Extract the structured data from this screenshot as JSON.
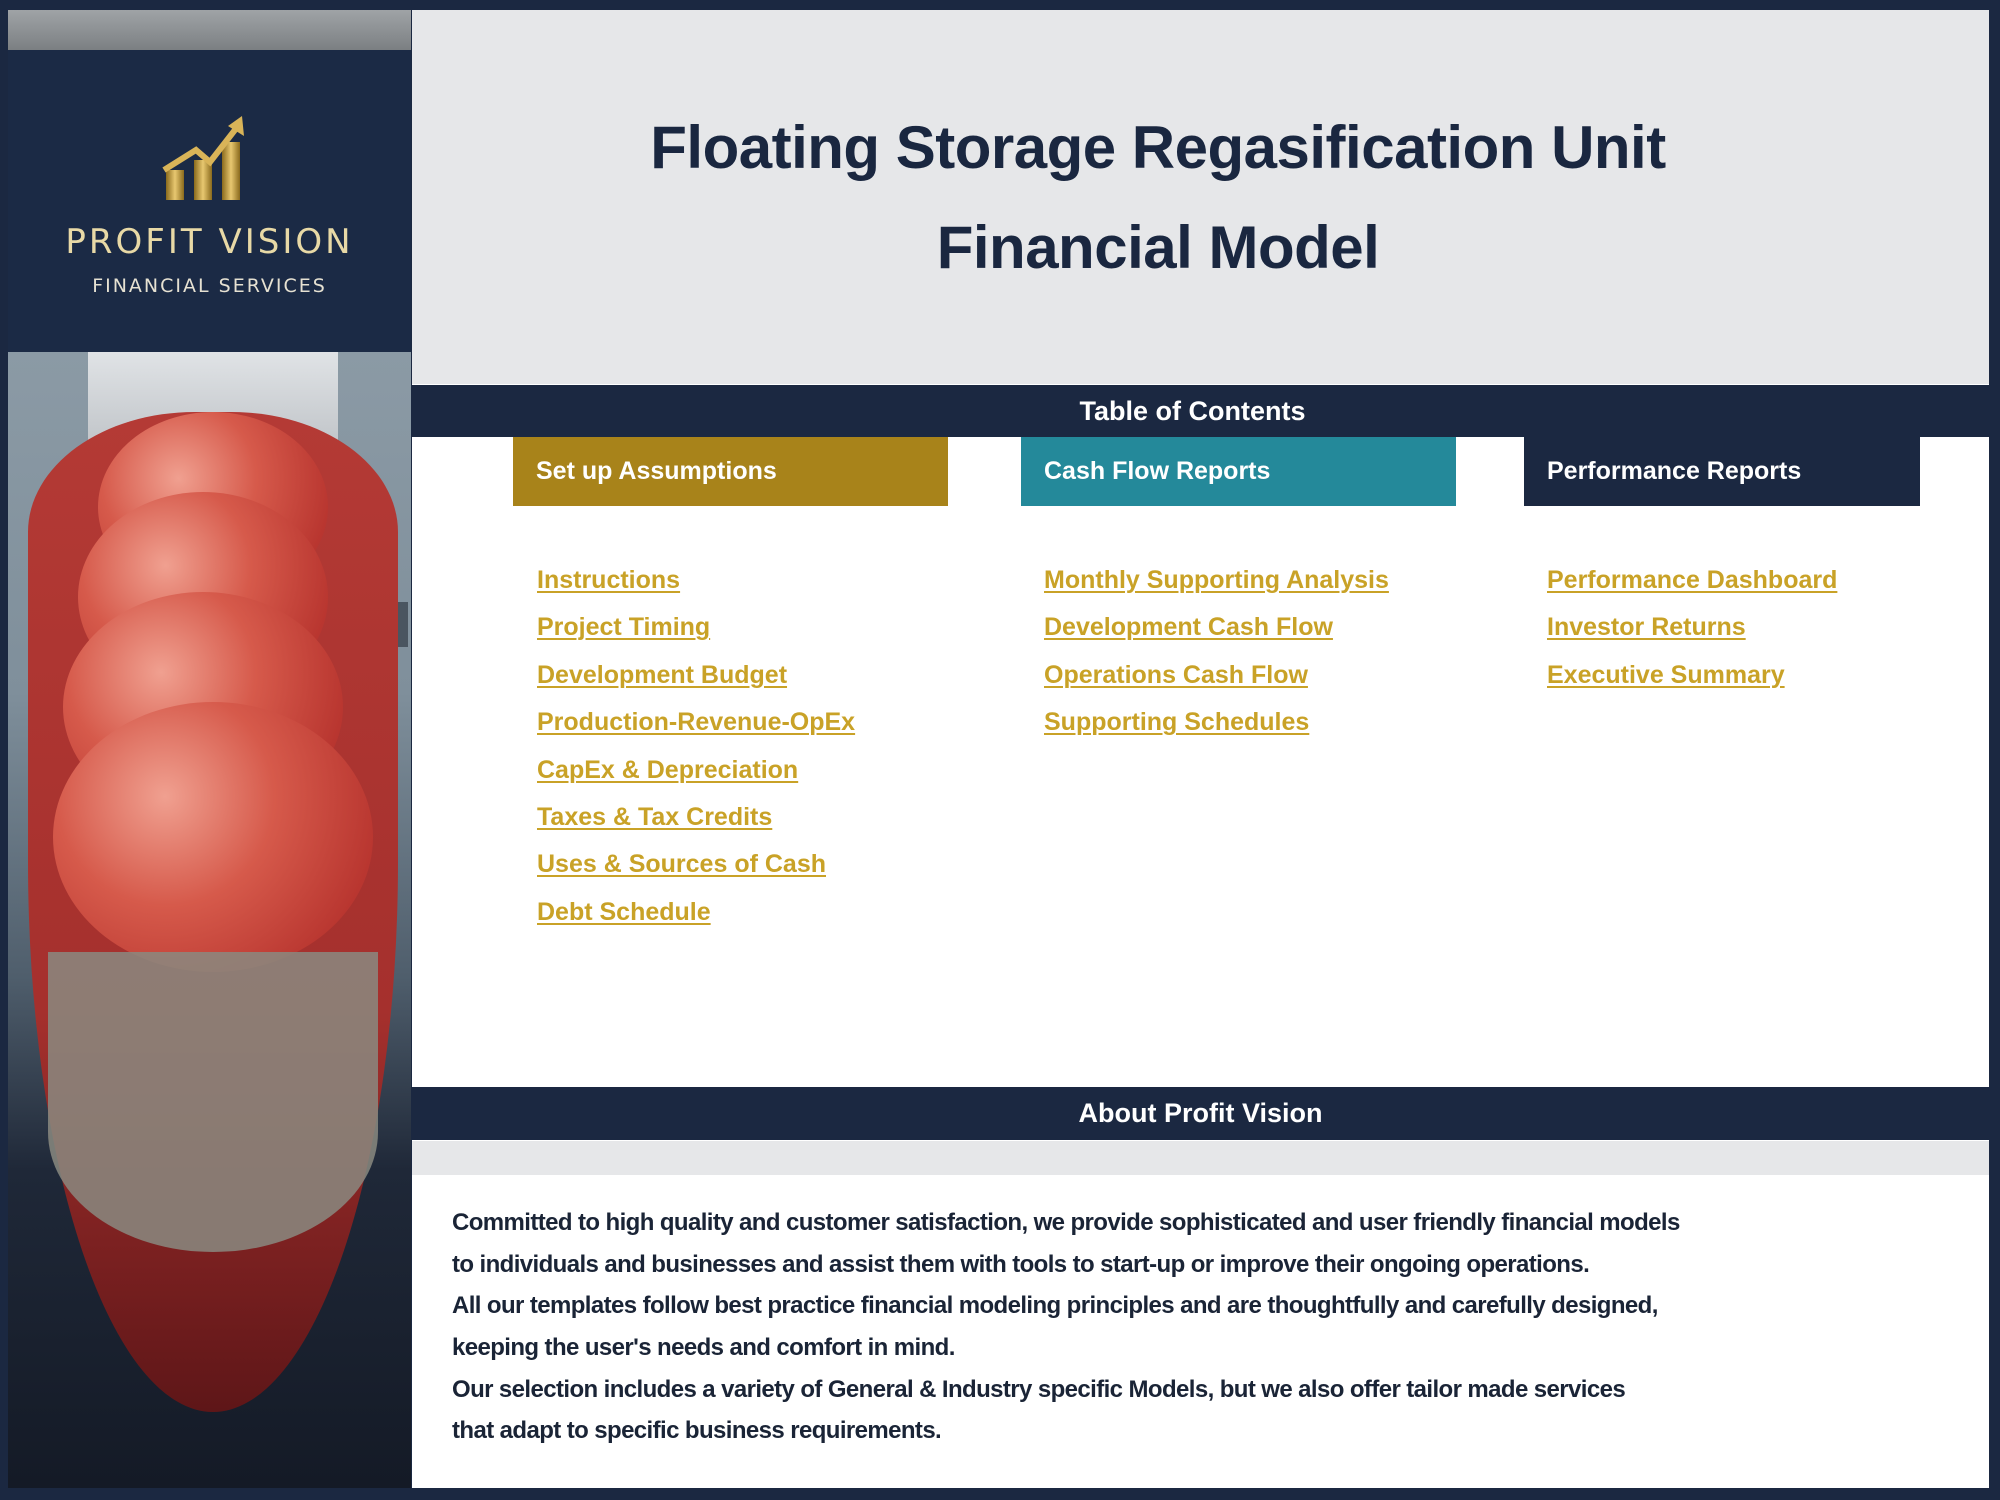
{
  "sidebar": {
    "brand_name": "PROFIT VISION",
    "brand_subtitle": "FINANCIAL SERVICES",
    "logo_icon": "rising-bar-chart-arrow-icon",
    "photo": "lng-carrier-ship-photo"
  },
  "header": {
    "title_line1": "Floating Storage Regasification Unit",
    "title_line2": "Financial Model"
  },
  "toc": {
    "title": "Table of Contents",
    "columns": [
      {
        "label": "Set up Assumptions",
        "color": "#a8831a",
        "links": [
          "Instructions",
          "Project Timing",
          "Development Budget",
          "Production-Revenue-OpEx",
          "CapEx & Depreciation",
          "Taxes & Tax Credits",
          "Uses & Sources of Cash",
          "Debt Schedule"
        ]
      },
      {
        "label": "Cash Flow Reports",
        "color": "#24899a",
        "links": [
          "Monthly Supporting Analysis",
          "Development Cash Flow",
          "Operations Cash Flow",
          "Supporting Schedules"
        ]
      },
      {
        "label": "Performance Reports",
        "color": "#1b2841",
        "links": [
          "Performance Dashboard",
          "Investor Returns",
          "Executive Summary"
        ]
      }
    ]
  },
  "about": {
    "title": "About Profit Vision",
    "lines": [
      "Committed to high quality and customer satisfaction, we provide sophisticated and user friendly financial models",
      "to individuals and businesses and assist them  with tools to start-up or improve their ongoing operations.",
      "All our templates follow best practice financial modeling principles and are thoughtfully and carefully designed,",
      "keeping the user's needs and comfort in mind.",
      "Our selection includes a variety of General & Industry specific Models, but we also offer tailor made services",
      "that adapt to specific business requirements."
    ]
  },
  "colors": {
    "navy": "#1b2841",
    "gold": "#a8831a",
    "teal": "#24899a",
    "link": "#c9a227",
    "header_bg": "#e6e7e9"
  }
}
